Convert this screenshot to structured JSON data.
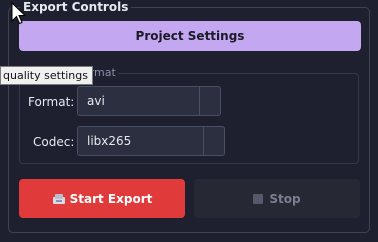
{
  "group": {
    "title": "Export Controls"
  },
  "settings_button": {
    "label": "Project Settings"
  },
  "format_group": {
    "title": "Format"
  },
  "tooltip": {
    "text": "quality settings"
  },
  "format": {
    "label": "Format:",
    "value": "avi"
  },
  "codec": {
    "label": "Codec:",
    "value": "libx265"
  },
  "start_button": {
    "label": "Start Export",
    "icon": "disk-export-icon"
  },
  "stop_button": {
    "label": "Stop",
    "icon": "stop-icon"
  },
  "colors": {
    "background": "#1e2030",
    "settings_button": "#c4a7f1",
    "start_button": "#e03a3a",
    "stop_button": "#262834"
  }
}
